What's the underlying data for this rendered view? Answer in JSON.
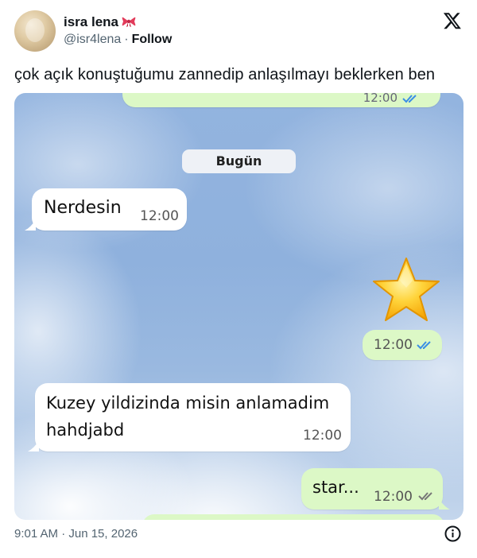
{
  "author": {
    "name": "isra lena",
    "handle": "@isr4lena",
    "separator": "·",
    "follow_label": "Follow",
    "name_emoji_icon": "ribbon-bow-icon"
  },
  "brand": {
    "logo_icon": "x-logo-icon"
  },
  "tweet": {
    "text": "çok açık konuştuğumu zannedip anlaşılmayı beklerken ben",
    "timestamp": "9:01 AM · Jun 15, 2026"
  },
  "chat": {
    "date_chip": "Bugün",
    "messages": [
      {
        "direction": "incoming",
        "text": "Nerdesin",
        "time": "12:00"
      },
      {
        "direction": "outgoing",
        "type": "sticker",
        "icon": "star-emoji-icon",
        "time": "12:00",
        "status": "read"
      },
      {
        "direction": "incoming",
        "text_lines": [
          "Kuzey yildizinda misin anlamadim",
          "hahdjabd"
        ],
        "time": "12:00"
      },
      {
        "direction": "outgoing",
        "text": "star...",
        "time": "12:00",
        "status": "delivered"
      }
    ],
    "partial_top_time": "12:00"
  },
  "colors": {
    "incoming_bubble": "#ffffff",
    "outgoing_bubble": "#dcf8c6",
    "read_check": "#3a8ee6",
    "delivered_check": "#777777",
    "chat_background": "#93b4df"
  }
}
